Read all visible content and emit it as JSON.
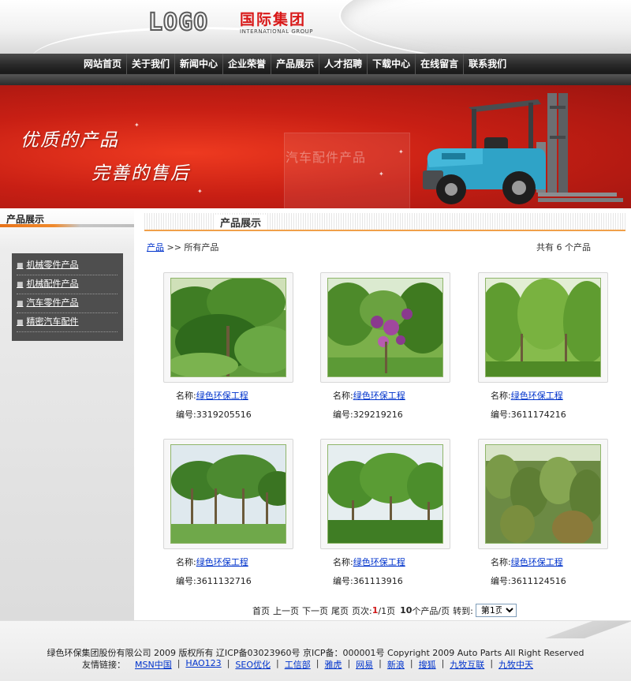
{
  "header": {
    "logo_mark": "LOGO",
    "logo_cn": "国际集团",
    "logo_en": "INTERNATIONAL GROUP"
  },
  "nav": {
    "items": [
      "网站首页",
      "关于我们",
      "新闻中心",
      "企业荣誉",
      "产品展示",
      "人才招聘",
      "下载中心",
      "在线留言",
      "联系我们"
    ]
  },
  "banner": {
    "slogan1": "优质的产品",
    "slogan2": "完善的售后",
    "watermark": "汽车配件产品"
  },
  "sidebar": {
    "title": "产品展示",
    "categories": [
      "机械零件产品",
      "机械配件产品",
      "汽车零件产品",
      "精密汽车配件"
    ]
  },
  "main": {
    "title": "产品展示",
    "breadcrumb_link": "产品",
    "breadcrumb_rest": ">> 所有产品",
    "count_text": "共有 6 个产品",
    "name_label": "名称:",
    "code_label": "编号:",
    "products": [
      {
        "name": "绿色环保工程",
        "code": "3319205516"
      },
      {
        "name": "绿色环保工程",
        "code": "329219216"
      },
      {
        "name": "绿色环保工程",
        "code": "3611174216"
      },
      {
        "name": "绿色环保工程",
        "code": "3611132716"
      },
      {
        "name": "绿色环保工程",
        "code": "361113916"
      },
      {
        "name": "绿色环保工程",
        "code": "3611124516"
      }
    ]
  },
  "pager": {
    "first": "首页",
    "prev": "上一页",
    "next": "下一页",
    "last": "尾页",
    "page_label": "页次:",
    "current": "1",
    "sep_total": "/1页",
    "per_page": "10",
    "per_page_suffix": "个产品/页",
    "goto_label": "转到:",
    "select_value": "第1页"
  },
  "footer": {
    "copyright": "绿色环保集团股份有限公司 2009 版权所有 辽ICP备03023960号 京ICP备：000001号 Copyright 2009 Auto Parts All Right Reserved",
    "links_label": "友情链接：",
    "links": [
      "MSN中国",
      "HAO123",
      "SEO优化",
      "工信部",
      "雅虎",
      "网易",
      "新浪",
      "搜狐",
      "九牧互联",
      "九牧中天"
    ]
  },
  "colors": {
    "nav_bg": "#1a1a1a",
    "banner_red": "#c81f14",
    "accent_orange": "#f08a2c",
    "logo_red": "#d81818",
    "link_blue": "#0033cc"
  }
}
